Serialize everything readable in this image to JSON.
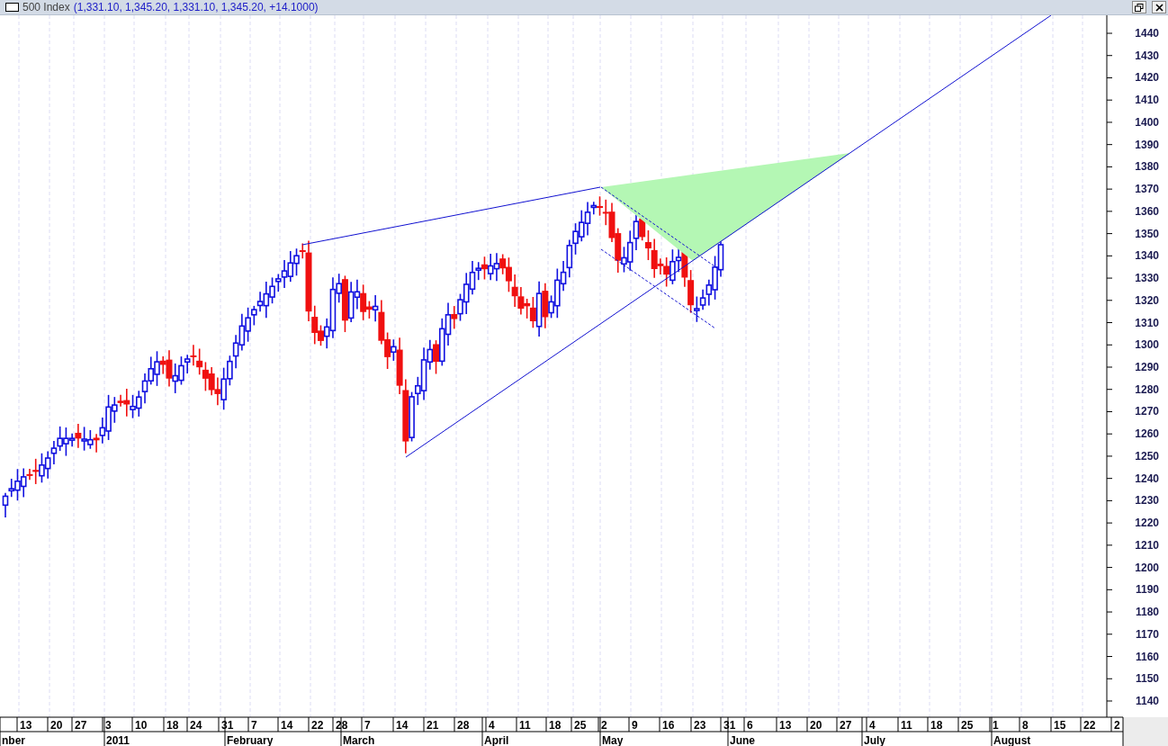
{
  "window": {
    "title": "500 Index",
    "quote": "(1,331.10, 1,345.20, 1,331.10, 1,345.20, +14.1000)"
  },
  "y_axis": {
    "labels": [
      "1440",
      "1430",
      "1420",
      "1410",
      "1400",
      "1390",
      "1380",
      "1370",
      "1360",
      "1350",
      "1340",
      "1330",
      "1320",
      "1310",
      "1300",
      "1290",
      "1280",
      "1270",
      "1260",
      "1250",
      "1240",
      "1230",
      "1220",
      "1210",
      "1200",
      "1190",
      "1180",
      "1170",
      "1160",
      "1150",
      "1140"
    ]
  },
  "x_axis": {
    "dates": [
      "13",
      "20",
      "27",
      "3",
      "10",
      "18",
      "24",
      "31",
      "7",
      "14",
      "22",
      "28",
      "7",
      "14",
      "21",
      "28",
      "4",
      "11",
      "18",
      "25",
      "2",
      "9",
      "16",
      "23",
      "31",
      "6",
      "13",
      "20",
      "27",
      "4",
      "11",
      "18",
      "25",
      "1",
      "8",
      "15",
      "22",
      "2"
    ],
    "months": [
      "nber",
      "2011",
      "February",
      "March",
      "April",
      "May",
      "June",
      "July",
      "August"
    ]
  }
}
